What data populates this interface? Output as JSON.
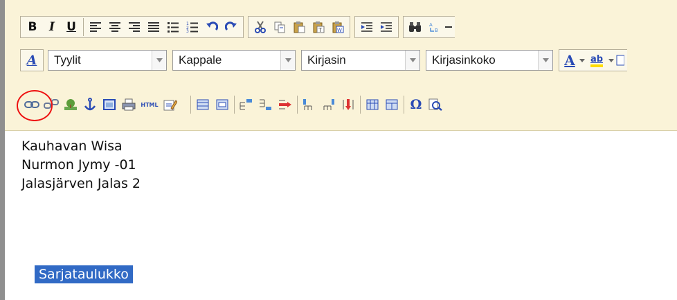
{
  "toolbar": {
    "row1": {
      "format_buttons": [
        {
          "label": "B",
          "icon": "bold-icon"
        },
        {
          "label": "I",
          "icon": "italic-icon"
        },
        {
          "label": "U",
          "icon": "underline-icon"
        }
      ],
      "align_icons": [
        "align-left-icon",
        "align-center-icon",
        "align-right-icon",
        "align-justify-icon",
        "bullet-list-icon",
        "numbered-list-icon",
        "undo-icon",
        "redo-icon"
      ],
      "edit_icons": [
        "cut-icon",
        "copy-icon",
        "paste-icon",
        "paste-text-icon",
        "paste-word-icon"
      ],
      "indent_icons": [
        "outdent-icon",
        "indent-icon"
      ],
      "find_icons": [
        "find-icon",
        "replace-icon"
      ]
    },
    "row2": {
      "styles_icon": "styles-icon",
      "styles_icon_label": "A",
      "dropdowns": [
        {
          "value": "Tyylit"
        },
        {
          "value": "Kappale"
        },
        {
          "value": "Kirjasin"
        },
        {
          "value": "Kirjasinkoko"
        }
      ],
      "text_color_label": "A",
      "highlight_label": "ab"
    },
    "row3": {
      "icons": [
        "link-icon",
        "unlink-icon",
        "image-icon",
        "anchor-icon",
        "embed-icon",
        "print-icon",
        "html-icon",
        "edit-icon",
        "table-icon",
        "table-props-icon",
        "insert-row-before-icon",
        "insert-row-after-icon",
        "delete-row-icon",
        "insert-col-before-icon",
        "insert-col-after-icon",
        "delete-col-icon",
        "split-cell-icon",
        "merge-cells-icon",
        "special-char-icon",
        "preview-icon"
      ],
      "html_label": "HTML",
      "omega_label": "Ω",
      "highlighted": "link-icon"
    }
  },
  "editor": {
    "lines": [
      "Kauhavan Wisa",
      "Nurmon Jymy -01",
      "Jalasjärven Jalas 2"
    ],
    "selected_text": "Sarjataulukko"
  },
  "colors": {
    "toolbar_bg": "#faf3d8",
    "selection": "#316ac5",
    "annotation_circle": "#e11111"
  }
}
